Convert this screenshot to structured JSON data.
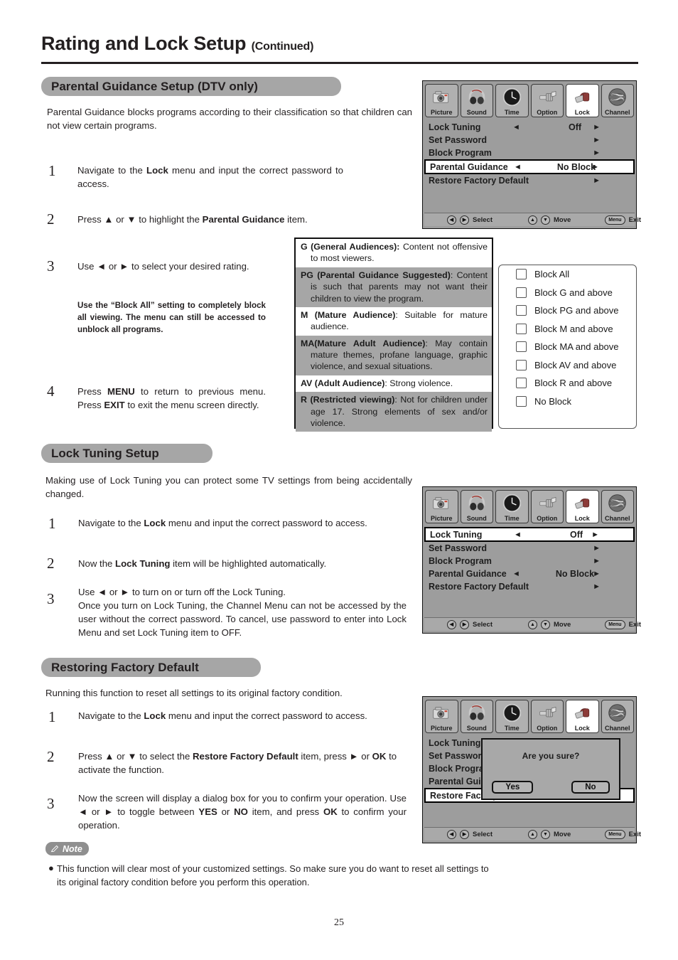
{
  "header": {
    "title": "Rating and Lock Setup",
    "continued": "(Continued)"
  },
  "page_number": "25",
  "sections": {
    "parental": {
      "pill": "Parental Guidance Setup (DTV only)",
      "intro": "Parental Guidance blocks programs according to their classification so that children can not view certain programs.",
      "steps": [
        {
          "num": "1",
          "text_html": "Navigate to the <b>Lock</b> menu and input the correct password to access."
        },
        {
          "num": "2",
          "text_html": "Press ▲ or ▼ to highlight the <b>Parental Guidance</b> item."
        },
        {
          "num": "3",
          "text_html": "Use ◄ or ► to select your desired rating."
        },
        {
          "num": "4",
          "text_html": "Press <b>MENU</b> to return to previous menu. Press <b>EXIT</b> to exit the menu screen directly."
        }
      ],
      "step3_note": "Use the “Block All” setting to completely block all viewing. The menu can still be accessed to unblock all programs."
    },
    "lock_tuning": {
      "pill": "Lock Tuning Setup",
      "intro": "Making use of Lock Tuning you can protect some TV settings from being accidentally changed.",
      "steps": [
        {
          "num": "1",
          "text_html": "Navigate to the <b>Lock</b> menu and input the correct password to access."
        },
        {
          "num": "2",
          "text_html": "Now the <b>Lock Tuning</b> item will be highlighted automatically."
        },
        {
          "num": "3",
          "text_html": "Use ◄ or ► to turn on or turn off the Lock Tuning.<br>Once you turn on Lock Tuning, the Channel Menu can not be accessed by the user without the correct password. To cancel, use password to enter into Lock Menu and set Lock Tuning item to OFF."
        }
      ]
    },
    "restore": {
      "pill": "Restoring Factory Default",
      "intro": "Running this function to reset all settings to its original factory condition.",
      "steps": [
        {
          "num": "1",
          "text_html": "Navigate to the <b>Lock</b> menu and input the correct password to access."
        },
        {
          "num": "2",
          "text_html": "Press ▲ or ▼ to select the <b>Restore Factory Default</b> item, press ► or <b>OK</b> to activate the function."
        },
        {
          "num": "3",
          "text_html": "Now the screen will display a dialog box for you to confirm your operation. Use ◄ or ► to toggle between <b>YES</b> or <b>NO</b> item, and press <b>OK</b> to confirm your operation."
        }
      ]
    }
  },
  "note": {
    "label": "Note",
    "text": "This function will clear most of your customized settings.  So make sure you do want to reset all settings to its original factory condition before you perform this operation."
  },
  "osd": {
    "tabs": [
      {
        "label": "Picture",
        "icon": "camera-icon",
        "selected": false
      },
      {
        "label": "Sound",
        "icon": "headphones-icon",
        "selected": false
      },
      {
        "label": "Time",
        "icon": "clock-icon",
        "selected": false
      },
      {
        "label": "Option",
        "icon": "connector-icon",
        "selected": false
      },
      {
        "label": "Lock",
        "icon": "padlock-icon",
        "selected": true
      },
      {
        "label": "Channel",
        "icon": "globe-icon",
        "selected": false
      }
    ],
    "footer": {
      "select": "Select",
      "move": "Move",
      "exit": "Exit",
      "menu_key": "Menu"
    },
    "menu_a": {
      "rows": [
        {
          "label": "Lock Tuning",
          "value": "Off",
          "left_arrow": true,
          "right_arrow": true,
          "highlight": false
        },
        {
          "label": "Set Password",
          "value": "",
          "left_arrow": false,
          "right_arrow": true,
          "highlight": false
        },
        {
          "label": "Block Program",
          "value": "",
          "left_arrow": false,
          "right_arrow": true,
          "highlight": false
        },
        {
          "label": "Parental Guidance",
          "value": "No Block",
          "left_arrow": true,
          "right_arrow": true,
          "highlight": true
        },
        {
          "label": "Restore Factory Default",
          "value": "",
          "left_arrow": false,
          "right_arrow": true,
          "highlight": false
        }
      ]
    },
    "menu_b": {
      "rows": [
        {
          "label": "Lock Tuning",
          "value": "Off",
          "left_arrow": true,
          "right_arrow": true,
          "highlight": true
        },
        {
          "label": "Set Password",
          "value": "",
          "left_arrow": false,
          "right_arrow": true,
          "highlight": false
        },
        {
          "label": "Block Program",
          "value": "",
          "left_arrow": false,
          "right_arrow": true,
          "highlight": false
        },
        {
          "label": "Parental Guidance",
          "value": "No Block",
          "left_arrow": true,
          "right_arrow": true,
          "highlight": false
        },
        {
          "label": "Restore Factory Default",
          "value": "",
          "left_arrow": false,
          "right_arrow": true,
          "highlight": false
        }
      ]
    },
    "menu_c": {
      "rows": [
        {
          "label": "Lock Tuning",
          "value": "",
          "left_arrow": false,
          "right_arrow": false,
          "highlight": false
        },
        {
          "label": "Set Password",
          "value": "",
          "left_arrow": false,
          "right_arrow": false,
          "highlight": false
        },
        {
          "label": "Block Program",
          "value": "",
          "left_arrow": false,
          "right_arrow": false,
          "highlight": false
        },
        {
          "label": "Parental Guidance",
          "value": "",
          "left_arrow": false,
          "right_arrow": false,
          "highlight": false
        },
        {
          "label": "Restore Factory Default",
          "value": "",
          "left_arrow": false,
          "right_arrow": true,
          "highlight": true
        }
      ],
      "dialog": {
        "title": "Are you sure?",
        "yes": "Yes",
        "no": "No"
      }
    }
  },
  "ratings_table": [
    {
      "shaded": false,
      "html": "<b>G  (General   Audiences):</b> Content   not offensive to most viewers."
    },
    {
      "shaded": true,
      "html": "<b>PG  (Parental   Guidance   Suggested)</b>: Content is such that parents may not want their children to view the program."
    },
    {
      "shaded": false,
      "html": "<b>M (Mature Audience)</b>: Suitable for mature audience."
    },
    {
      "shaded": true,
      "html": "<b>MA(Mature Adult Audience)</b>: May contain mature themes, profane language, graphic violence, and sexual situations."
    },
    {
      "shaded": false,
      "html": "<b>AV (Adult Audience)</b>: Strong violence."
    },
    {
      "shaded": true,
      "html": "<b>R  (Restricted  viewing)</b>: Not for children under age 17. Strong elements of sex and/or violence."
    }
  ],
  "block_options": [
    "Block All",
    "Block G and above",
    "Block PG and above",
    "Block M and above",
    "Block MA and above",
    "Block AV and above",
    "Block R and above",
    "No Block"
  ],
  "colors": {
    "pill_grey": "#a6a6a6",
    "osd_grey": "#9d9d9d",
    "shade_grey": "#a6a6a6",
    "text": "#231f20",
    "note_pill": "#8f8f8f"
  }
}
